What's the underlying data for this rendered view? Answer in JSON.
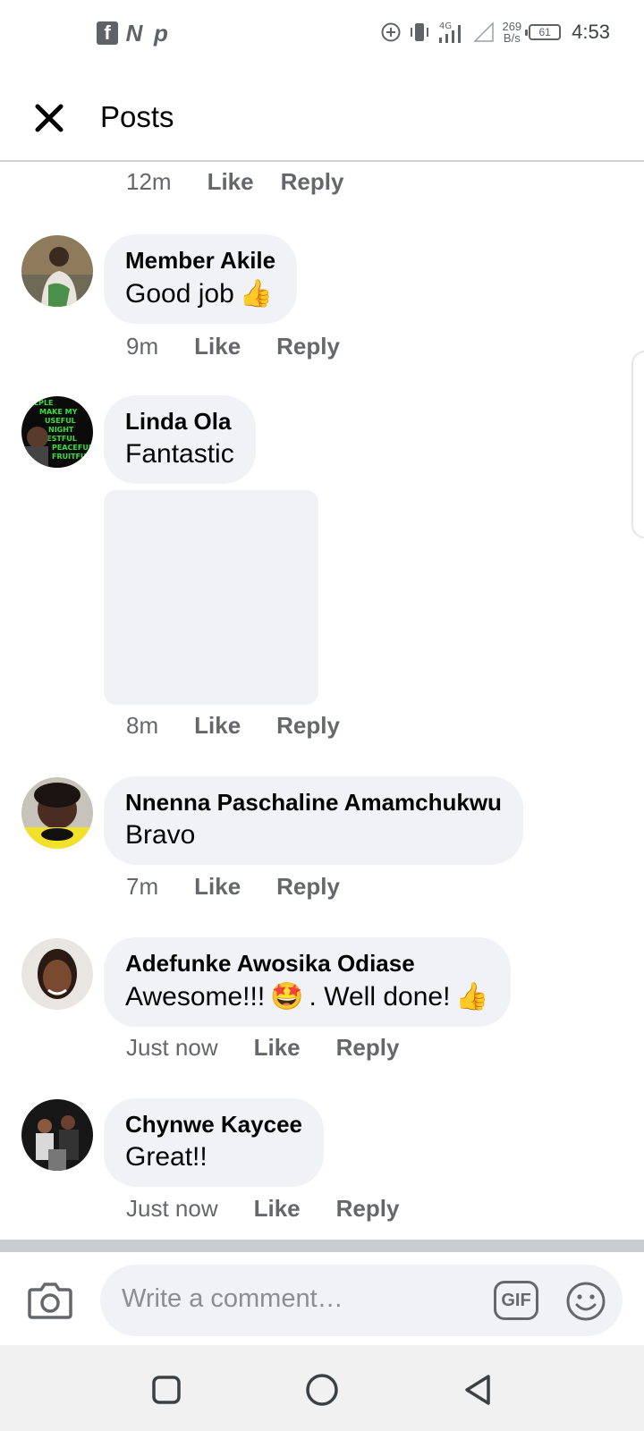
{
  "status_bar": {
    "app_icons": [
      "f",
      "N",
      "p"
    ],
    "network_speed_value": "269",
    "network_speed_unit": "B/s",
    "network_type": "4G",
    "battery": "61",
    "time": "4:53"
  },
  "header": {
    "title": "Posts"
  },
  "actions": {
    "like": "Like",
    "reply": "Reply"
  },
  "top_meta": {
    "time": "12m"
  },
  "comments": [
    {
      "name": "Member Akile",
      "text": "Good job",
      "emoji": "👍",
      "time": "9m"
    },
    {
      "name": "Linda Ola",
      "text": "Fantastic",
      "time": "8m"
    },
    {
      "name": "Nnenna Paschaline Amamchukwu",
      "text": "Bravo",
      "time": "7m"
    },
    {
      "name": "Adefunke Awosika Odiase",
      "text_a": "Awesome!!!",
      "emoji_a": "🤩",
      "text_b": ". Well done!",
      "emoji_b": "👍",
      "time": "Just now"
    },
    {
      "name": "Chynwe Kaycee",
      "text": "Great!!",
      "time": "Just now"
    }
  ],
  "composer": {
    "placeholder": "Write a comment…",
    "gif_label": "GIF"
  }
}
